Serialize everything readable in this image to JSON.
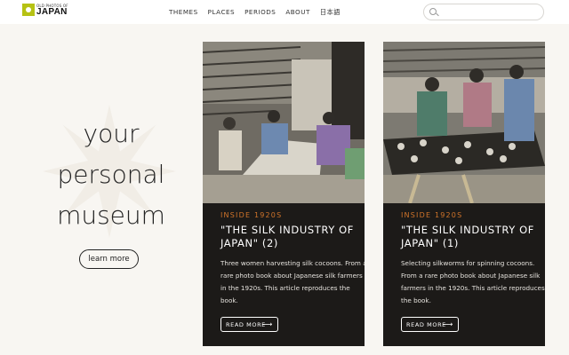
{
  "header": {
    "logo_small": "OLD PHOTOS OF",
    "logo_big": "JAPAN",
    "nav": [
      "THEMES",
      "PLACES",
      "PERIODS",
      "ABOUT",
      "日本語"
    ],
    "search_placeholder": ""
  },
  "hero": {
    "title_lines": [
      "your",
      "personal",
      "museum"
    ],
    "button_label": "learn more"
  },
  "cards": [
    {
      "kicker": "INSIDE 1920S",
      "title": "\"THE SILK INDUSTRY OF JAPAN\" (2)",
      "description": "Three women harvesting silk cocoons. From a rare photo book about Japanese silk farmers in the 1920s. This article reproduces the book.",
      "button": "READ MORE",
      "arrow": "⟶"
    },
    {
      "kicker": "INSIDE 1920S",
      "title": "\"THE SILK INDUSTRY OF JAPAN\" (1)",
      "description": "Selecting silkworms for spinning cocoons. From a rare photo book about Japanese silk farmers in the 1920s. This article reproduces the book.",
      "button": "READ MORE",
      "arrow": "⟶"
    }
  ],
  "colors": {
    "accent": "#d1742a",
    "logo": "#b6c214",
    "card_bg": "#1c1a18",
    "page_bg": "#f8f6f2"
  }
}
